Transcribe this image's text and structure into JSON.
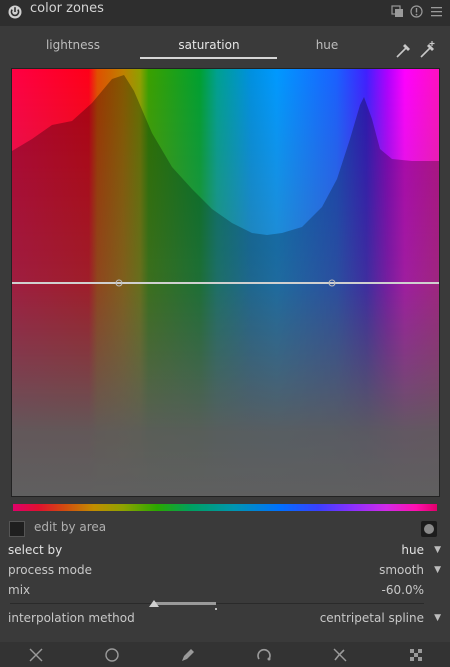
{
  "module": {
    "title": "color zones"
  },
  "tabs": [
    {
      "label": "lightness",
      "active": false
    },
    {
      "label": "saturation",
      "active": true
    },
    {
      "label": "hue",
      "active": false
    }
  ],
  "controls": {
    "edit_by_area": {
      "label": "edit by area",
      "checked": false
    },
    "select_by": {
      "label": "select by",
      "value": "hue"
    },
    "process_mode": {
      "label": "process mode",
      "value": "smooth"
    },
    "mix": {
      "label": "mix",
      "value": "-60.0%",
      "level_percent": -60
    },
    "interpolation_method": {
      "label": "interpolation method",
      "value": "centripetal spline"
    }
  },
  "icons": {
    "header": [
      "power-icon",
      "presets-icon",
      "reset-icon",
      "menu-icon"
    ],
    "pickers": [
      "color-picker-icon",
      "color-picker-set-values-icon"
    ],
    "bottom_bar": [
      "close-icon",
      "circle-icon",
      "pencil-icon",
      "arc-icon",
      "disabled-icon",
      "checker-icon"
    ]
  },
  "colors": {
    "background": "#3a3a3a",
    "header": "#2e2e2e",
    "curve": "#d0d0d0",
    "text": "#c8c8c8"
  }
}
